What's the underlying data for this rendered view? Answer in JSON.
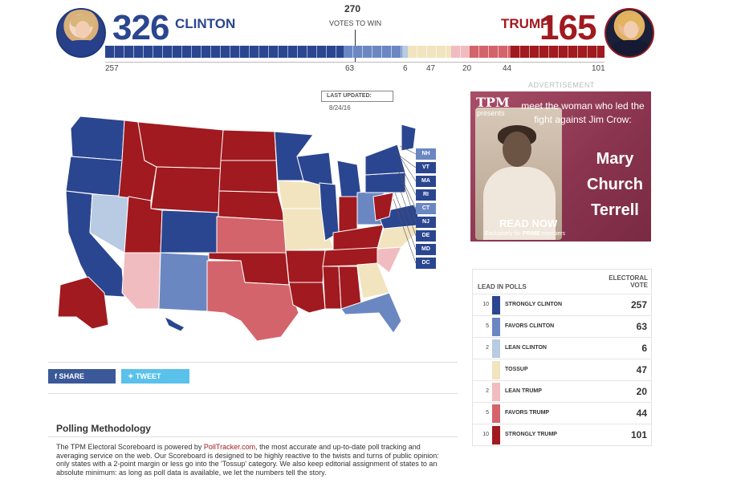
{
  "header": {
    "clinton": {
      "name": "CLINTON",
      "total": "326"
    },
    "trump": {
      "name": "TRUMP",
      "total": "165"
    },
    "votes_to_win_number": "270",
    "votes_to_win_label": "VOTES TO WIN"
  },
  "bar": {
    "segments": [
      {
        "category": "strongly-clinton",
        "value": 257,
        "color": "#2b4690"
      },
      {
        "category": "favors-clinton",
        "value": 63,
        "color": "#6b87c2"
      },
      {
        "category": "lean-clinton",
        "value": 6,
        "color": "#b8cbe2"
      },
      {
        "category": "tossup",
        "value": 47,
        "color": "#f2e4bf"
      },
      {
        "category": "lean-trump",
        "value": 20,
        "color": "#f0bcc0"
      },
      {
        "category": "favors-trump",
        "value": 44,
        "color": "#d4646b"
      },
      {
        "category": "strongly-trump",
        "value": 101,
        "color": "#a01a1f"
      }
    ],
    "labels": [
      "257",
      "63",
      "6",
      "47",
      "20",
      "44",
      "101"
    ]
  },
  "last_updated": {
    "label": "LAST UPDATED:",
    "date": "8/24/16"
  },
  "small_states": [
    {
      "abbr": "NH",
      "color": "#6b87c2"
    },
    {
      "abbr": "VT",
      "color": "#2b4690"
    },
    {
      "abbr": "MA",
      "color": "#2b4690"
    },
    {
      "abbr": "RI",
      "color": "#2b4690"
    },
    {
      "abbr": "CT",
      "color": "#6b87c2"
    },
    {
      "abbr": "NJ",
      "color": "#2b4690"
    },
    {
      "abbr": "DE",
      "color": "#2b4690"
    },
    {
      "abbr": "MD",
      "color": "#2b4690"
    },
    {
      "abbr": "DC",
      "color": "#2b4690"
    }
  ],
  "share": {
    "facebook": "SHARE",
    "twitter": "TWEET"
  },
  "methodology": {
    "title": "Polling Methodology",
    "text_before_link": "The TPM Electoral Scoreboard is powered by ",
    "link": "PollTracker.com",
    "text_after_link": ", the most accurate and up-to-date poll tracking and averaging service on the web. Our Scoreboard is designed to be highly reactive to the twists and turns of public opinion: only states with a 2-point margin or less go into the 'Tossup' category. We also keep editorial assignment of states to an absolute minimum: as long as poll data is available, we let the numbers tell the story."
  },
  "advertisement": {
    "label": "ADVERTISEMENT",
    "brand": "TPM",
    "presents": "presents",
    "tagline": "meet the woman who led the fight against Jim Crow:",
    "name_line1": "Mary",
    "name_line2": "Church",
    "name_line3": "Terrell",
    "cta": "READ NOW",
    "sub_prefix": "Exclusively for ",
    "sub_bold": "PRIME",
    "sub_suffix": " members"
  },
  "legend": {
    "header_left": "LEAD IN POLLS",
    "header_right": "ELECTORAL VOTE",
    "rows": [
      {
        "count": "10",
        "label": "STRONGLY CLINTON",
        "value": "257",
        "color": "#2b4690"
      },
      {
        "count": "5",
        "label": "FAVORS CLINTON",
        "value": "63",
        "color": "#6b87c2"
      },
      {
        "count": "2",
        "label": "LEAN CLINTON",
        "value": "6",
        "color": "#b8cbe2"
      },
      {
        "count": "",
        "label": "TOSSUP",
        "value": "47",
        "color": "#f2e4bf"
      },
      {
        "count": "2",
        "label": "LEAN TRUMP",
        "value": "20",
        "color": "#f0bcc0"
      },
      {
        "count": "5",
        "label": "FAVORS TRUMP",
        "value": "44",
        "color": "#d4646b"
      },
      {
        "count": "10",
        "label": "STRONGLY TRUMP",
        "value": "101",
        "color": "#a01a1f"
      }
    ]
  }
}
